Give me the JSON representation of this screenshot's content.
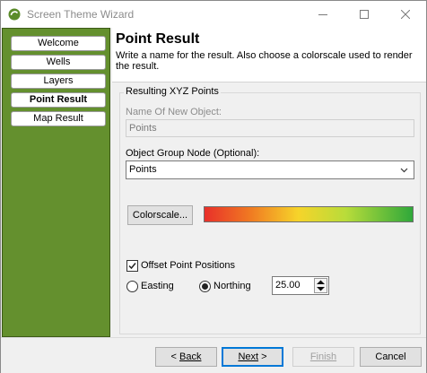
{
  "window": {
    "title": "Screen Theme Wizard"
  },
  "nav": {
    "items": [
      {
        "label": "Welcome"
      },
      {
        "label": "Wells"
      },
      {
        "label": "Layers"
      },
      {
        "label": "Point Result"
      },
      {
        "label": "Map Result"
      }
    ],
    "active_index": 3
  },
  "header": {
    "title": "Point Result",
    "description": "Write a name for the result. Also choose a colorscale used to render the result."
  },
  "group": {
    "label": "Resulting XYZ Points",
    "name_label": "Name Of New Object:",
    "name_value": "Points",
    "node_label": "Object Group Node (Optional):",
    "node_value": "Points",
    "colorscale_button": "Colorscale...",
    "colorscale_colors": [
      "#e8302a",
      "#f07a22",
      "#f6d42a",
      "#b8dc3a",
      "#2fa83a"
    ],
    "offset_label": "Offset Point Positions",
    "offset_checked": true,
    "easting_label": "Easting",
    "northing_label": "Northing",
    "selected_direction": "Northing",
    "offset_value": "25.00"
  },
  "buttons": {
    "back_label": "Back",
    "back_prefix": "< ",
    "next_label": "Next",
    "next_suffix": " >",
    "finish_label": "Finish",
    "cancel_label": "Cancel"
  },
  "icons": {
    "app": "app-logo-icon",
    "minimize": "minimize-icon",
    "maximize": "maximize-icon",
    "close": "close-icon",
    "dropdown": "chevron-down-icon",
    "spinner": "spinner-arrows-icon",
    "check": "checkmark-icon"
  },
  "colors": {
    "nav_panel": "#64902e",
    "default_button_border": "#0078d7"
  }
}
